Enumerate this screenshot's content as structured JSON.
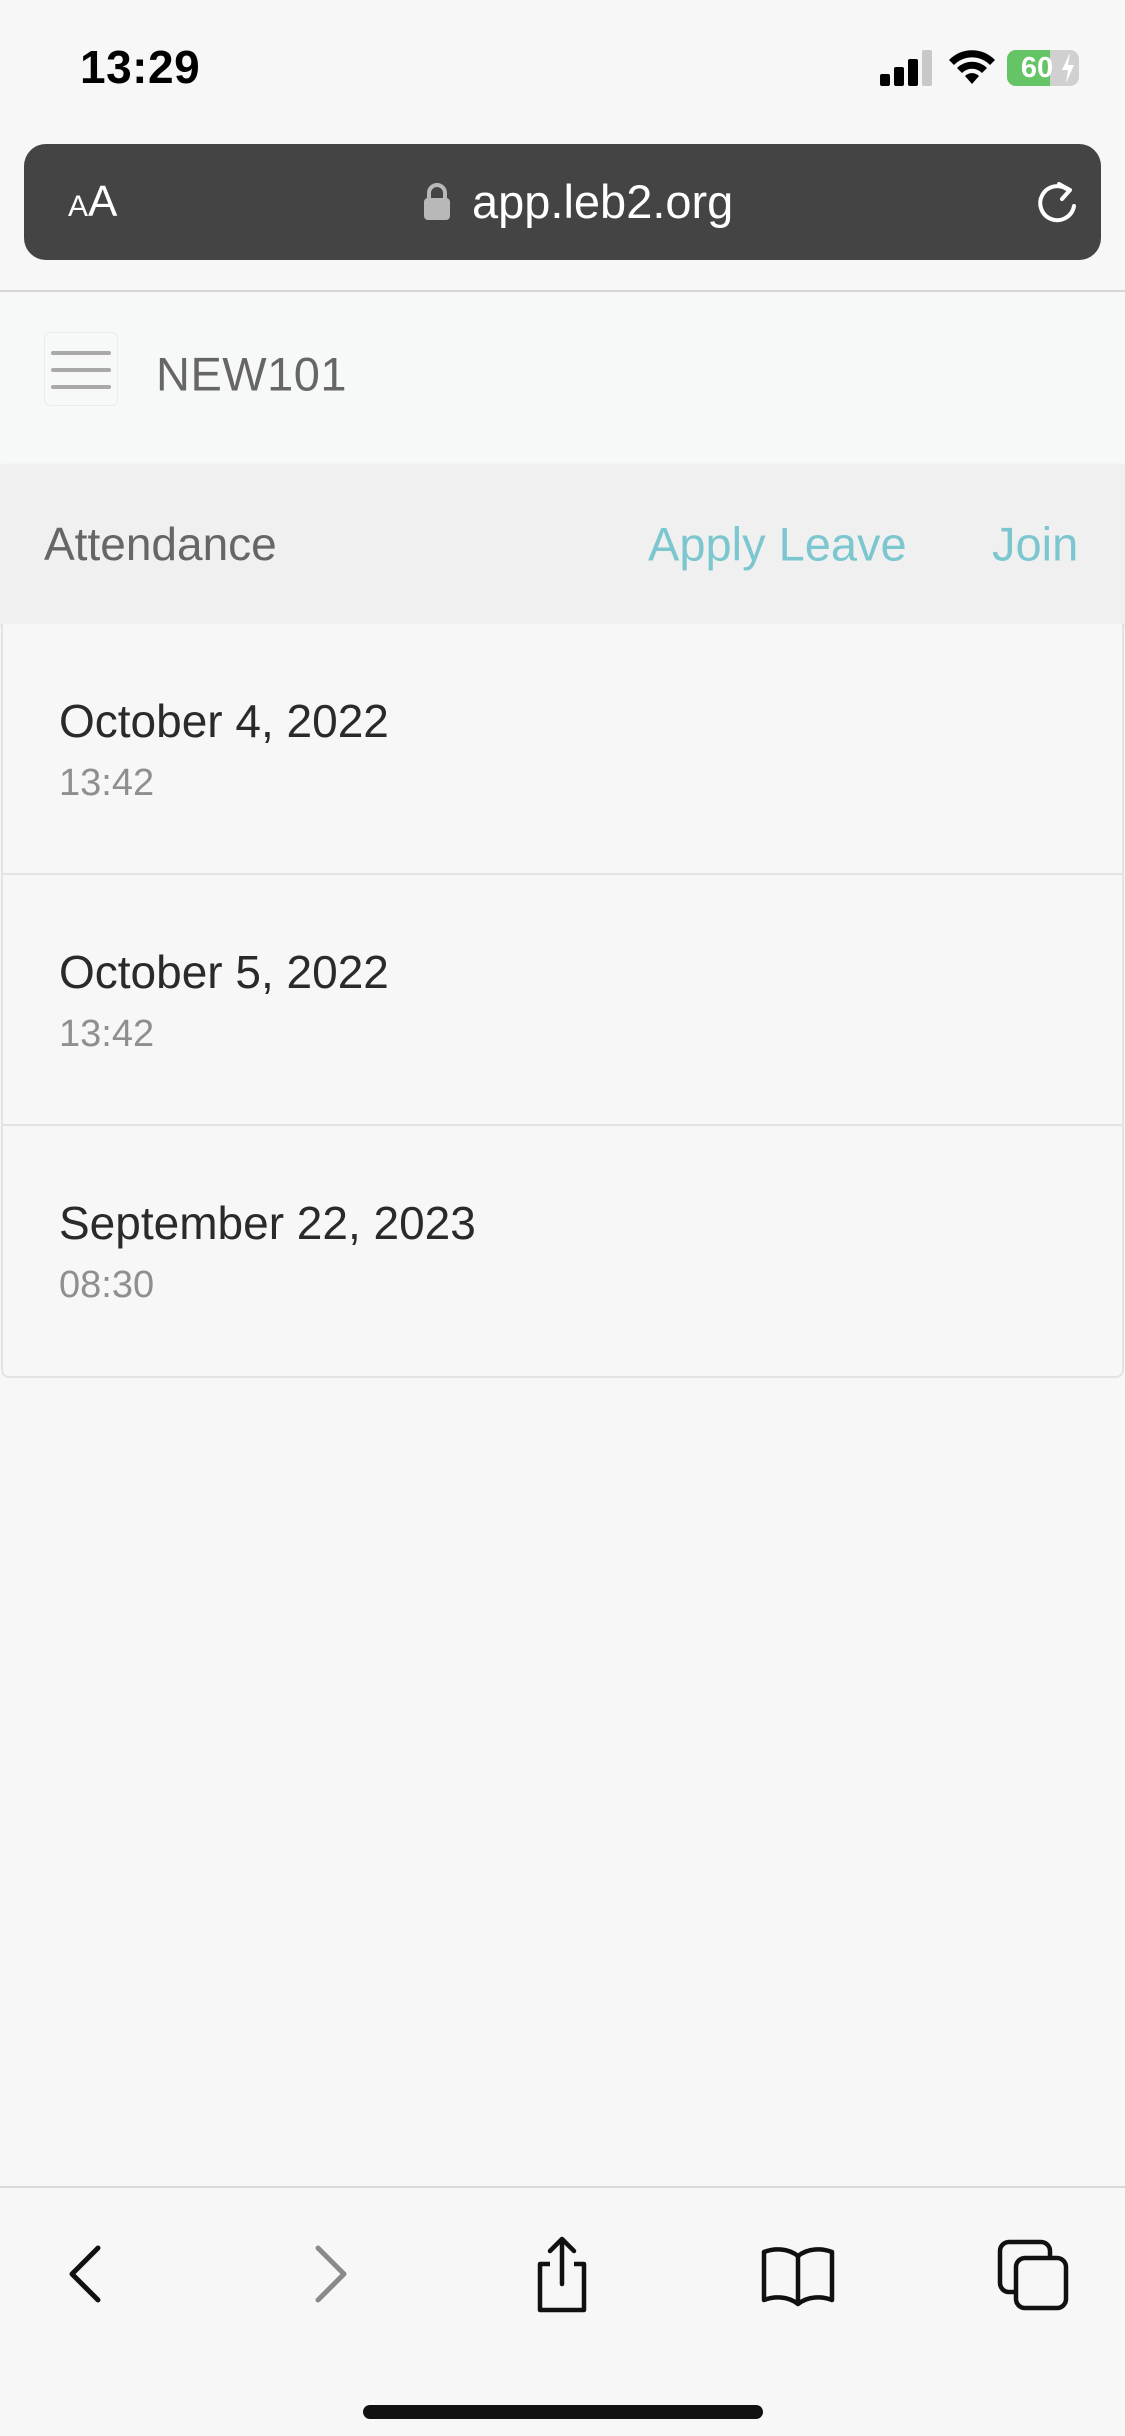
{
  "status_bar": {
    "time": "13:29",
    "battery_percent": 60,
    "battery_label": "60"
  },
  "browser": {
    "text_size_label": "AA",
    "url": "app.leb2.org",
    "icons": [
      "lock-icon",
      "reload-icon"
    ]
  },
  "app": {
    "title": "NEW101",
    "menu_icon": "hamburger-menu-icon"
  },
  "nav": {
    "title": "Attendance",
    "apply_leave": "Apply Leave",
    "join": "Join",
    "link_color": "#7cc7cf"
  },
  "attendance": {
    "items": [
      {
        "date": "October 4, 2022",
        "time": "13:42"
      },
      {
        "date": "October 5, 2022",
        "time": "13:42"
      },
      {
        "date": "September 22, 2023",
        "time": "08:30"
      }
    ]
  },
  "toolbar": {
    "icons": [
      "back-icon",
      "forward-icon",
      "share-icon",
      "bookmarks-icon",
      "tabs-icon"
    ]
  }
}
